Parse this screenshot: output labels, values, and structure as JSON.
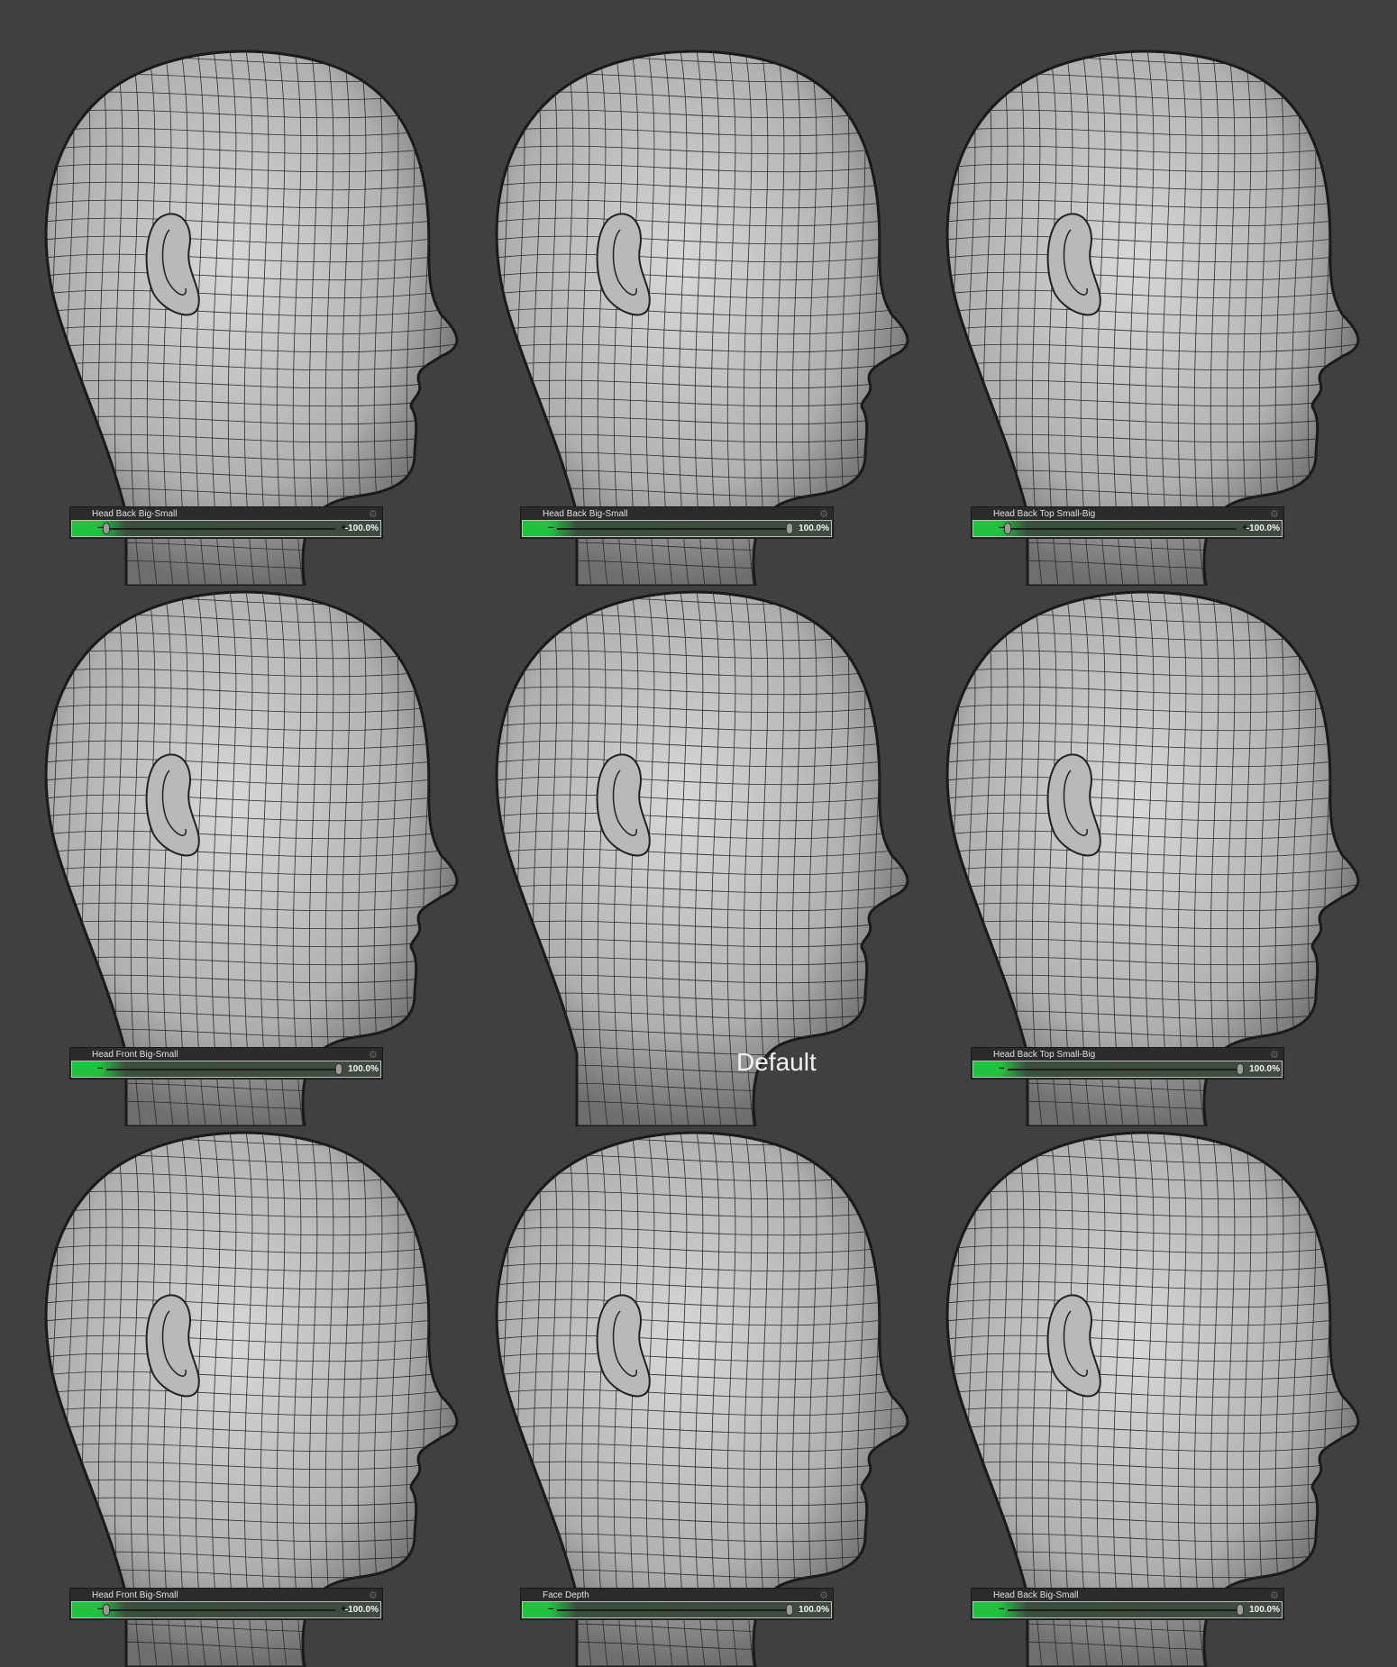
{
  "default_label": "Default",
  "colors": {
    "background": "#404040",
    "slider_accent": "#22c240"
  },
  "morphs": [
    {
      "name": "Head Back Big-Small",
      "value_text": "-100.0%",
      "value": -100
    },
    {
      "name": "Head Back Big-Small",
      "value_text": "100.0%",
      "value": 100
    },
    {
      "name": "Head Back Top Small-Big",
      "value_text": "-100.0%",
      "value": -100
    },
    {
      "name": "Head Front Big-Small",
      "value_text": "100.0%",
      "value": 100
    },
    {
      "name": "Head Back Top Small-Big",
      "value_text": "100.0%",
      "value": 100
    },
    {
      "name": "Head Front Big-Small",
      "value_text": "-100.0%",
      "value": -100
    },
    {
      "name": "Face Depth",
      "value_text": "100.0%",
      "value": 100
    },
    {
      "name": "Head Back Big-Small",
      "value_text": "100.0%",
      "value": 100
    }
  ],
  "icons": {
    "gear": "gear-icon",
    "minus": "minus-icon",
    "plus": "plus-icon"
  },
  "slider_symbols": {
    "minus": "−",
    "plus": "+",
    "gear": "⚙"
  }
}
